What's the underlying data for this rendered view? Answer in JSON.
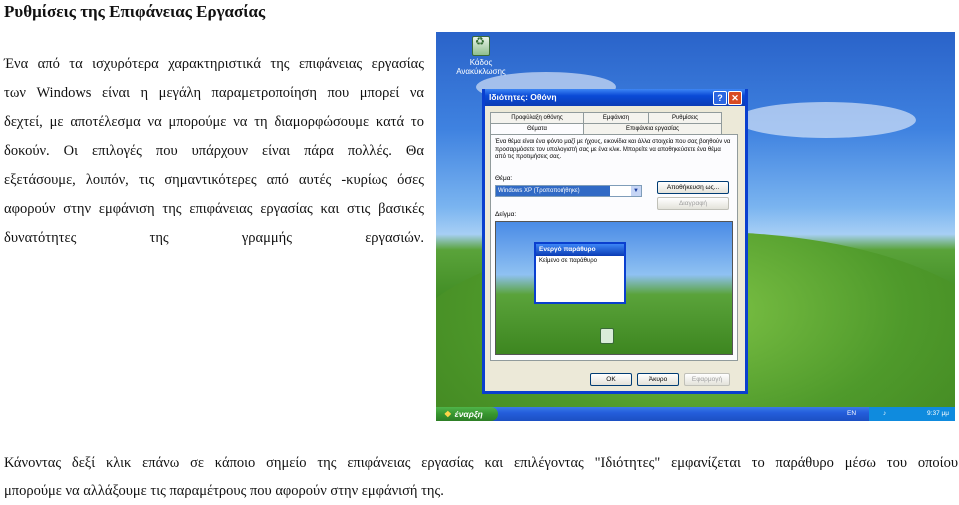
{
  "page": {
    "title": "Ρυθμίσεις της Επιφάνειας Εργασίας",
    "paragraph_lines": [
      "Ένα από τα ισχυρότερα χαρακτηριστικά της επιφάνειας εργασίας",
      "των Windows είναι η μεγάλη παραμετροποίηση που μπορεί να",
      "δεχτεί, με αποτέλεσμα να μπορούμε να τη διαμορφώσουμε κατά το",
      "δοκούν. Οι επιλογές που υπάρχουν είναι πάρα πολλές. Θα",
      "εξετάσουμε, λοιπόν, τις σημαντικότερες από αυτές -κυρίως όσες",
      "αφορούν στην εμφάνιση της επιφάνειας εργασίας και στις βασικές",
      "δυνατότητες της γραμμής εργασιών."
    ],
    "caption_lines": [
      "Κάνοντας δεξί κλικ επάνω σε κάποιο σημείο της επιφάνειας εργασίας και επιλέγοντας \"Ιδιότητες\" εμφανίζεται το παράθυρο μέσω του οποίου",
      "μπορούμε να αλλάξουμε τις παραμέτρους που αφορούν στην εμφάνισή της."
    ]
  },
  "screenshot": {
    "desktop_icon_label": "Κάδος Ανακύκλωσης",
    "dialog": {
      "title": "Ιδιότητες: Οθόνη",
      "help_glyph": "?",
      "close_glyph": "✕",
      "tabs": [
        "Προφύλαξη οθόνης",
        "Εμφάνιση",
        "Ρυθμίσεις",
        "Θέματα",
        "Επιφάνεια εργασίας"
      ],
      "description": "Ένα θέμα είναι ένα φόντο μαζί με ήχους, εικονίδια και άλλα στοιχεία που σας βοηθούν να προσαρμόσετε τον υπολογιστή σας με ένα κλικ. Μπορείτε να αποθηκεύσετε ένα θέμα από τις προτιμήσεις σας.",
      "theme_label": "Θέμα:",
      "theme_value": "Windows XP (Τροποποιήθηκε)",
      "save_as_button": "Αποθήκευση ως...",
      "delete_button": "Διαγραφή",
      "sample_label": "Δείγμα:",
      "preview_window_title": "Ενεργό παράθυρο",
      "preview_window_text": "Κείμενο σε παράθυρο",
      "ok_button": "OK",
      "cancel_button": "Άκυρο",
      "apply_button": "Εφαρμογή"
    },
    "taskbar": {
      "start_label": "έναρξη",
      "language": "EN",
      "clock": "9:37 μμ"
    },
    "colors": {
      "xp_blue": "#0a4ad6",
      "start_green": "#37962f",
      "dialog_bg": "#ece9d8"
    }
  }
}
